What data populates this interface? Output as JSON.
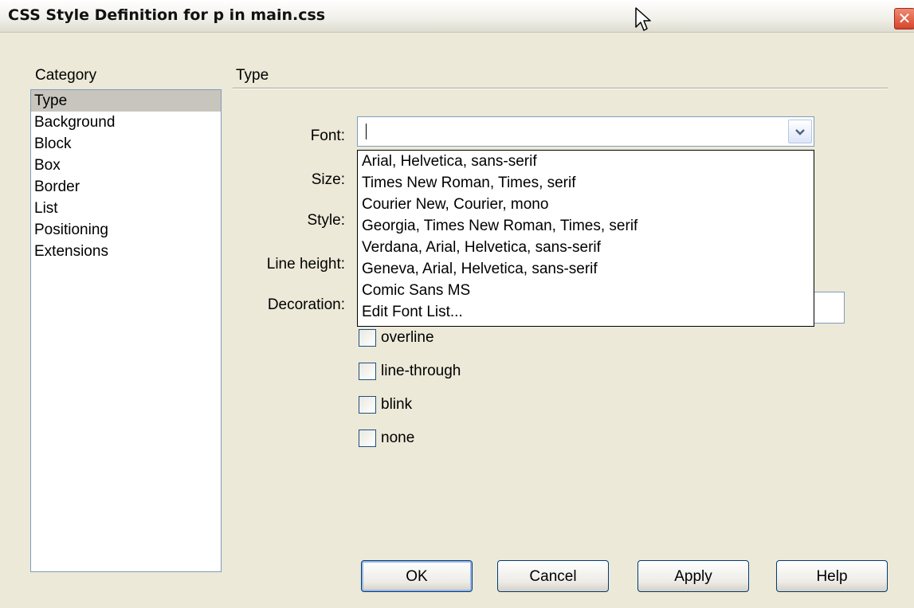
{
  "window": {
    "title": "CSS Style Definition for p in main.css",
    "close_glyph": "✕"
  },
  "category": {
    "label": "Category",
    "items": [
      "Type",
      "Background",
      "Block",
      "Box",
      "Border",
      "List",
      "Positioning",
      "Extensions"
    ],
    "selected": "Type"
  },
  "panel": {
    "title": "Type",
    "labels": {
      "font": "Font:",
      "size": "Size:",
      "style": "Style:",
      "line_height": "Line height:",
      "decoration": "Decoration:"
    },
    "font_value": "",
    "font_options": [
      "Arial, Helvetica, sans-serif",
      "Times New Roman, Times, serif",
      "Courier New, Courier, mono",
      "Georgia, Times New Roman, Times, serif",
      "Verdana, Arial, Helvetica, sans-serif",
      "Geneva, Arial, Helvetica, sans-serif",
      "Comic Sans MS",
      "Edit Font List..."
    ],
    "decoration_options": [
      "overline",
      "line-through",
      "blink",
      "none"
    ]
  },
  "buttons": {
    "ok": "OK",
    "cancel": "Cancel",
    "apply": "Apply",
    "help": "Help"
  },
  "icons": {
    "dropdown": "chevron-down-icon",
    "close": "close-icon",
    "cursor": "mouse-pointer-icon"
  },
  "colors": {
    "dialog_bg": "#ece9d8",
    "close_button": "#d5452b",
    "selection": "#c7c5bd",
    "button_border": "#003c74"
  }
}
